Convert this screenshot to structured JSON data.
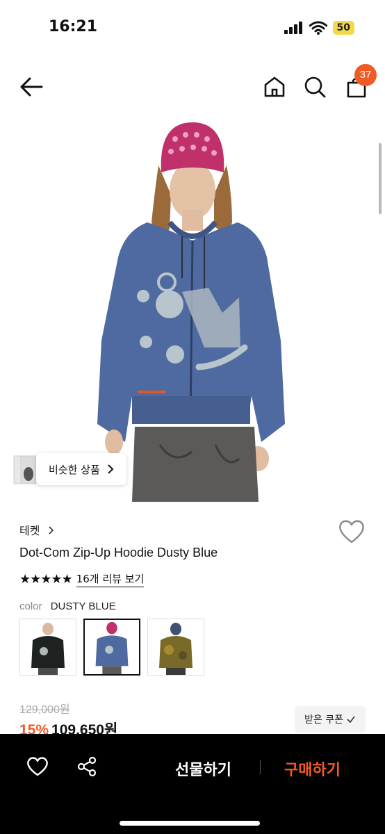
{
  "status_bar": {
    "time": "16:21",
    "battery": "50"
  },
  "header": {
    "cart_count": "37"
  },
  "similar": {
    "label": "비슷한 상품"
  },
  "product": {
    "brand": "테켓",
    "name": "Dot-Com Zip-Up Hoodie Dusty Blue",
    "stars": "★★★★★",
    "review_link": "16개 리뷰 보기",
    "color_label": "color",
    "color_value": "DUSTY BLUE",
    "original_price": "129,000원",
    "discount": "15%",
    "price": "109,650원",
    "coupon_label": "받은 쿠폰"
  },
  "bottom_bar": {
    "gift_label": "선물하기",
    "buy_label": "구매하기"
  },
  "colors": {
    "accent": "#f15a24",
    "hoodie": "#4f6aa0",
    "beanie": "#c0306a"
  }
}
